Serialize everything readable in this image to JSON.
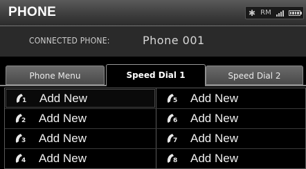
{
  "title": "PHONE",
  "status": {
    "bluetooth_icon": "bluetooth-icon",
    "rm_label": "RM",
    "signal_icon": "signal-strength-icon",
    "battery_icon": "battery-icon"
  },
  "connected": {
    "label": "CONNECTED PHONE:",
    "value": "Phone 001"
  },
  "tabs": [
    {
      "label": "Phone Menu",
      "active": false
    },
    {
      "label": "Speed Dial 1",
      "active": true
    },
    {
      "label": "Speed Dial 2",
      "active": false
    }
  ],
  "entries": [
    {
      "number": "1",
      "label": "Add New",
      "icon": "phone-handset-icon"
    },
    {
      "number": "2",
      "label": "Add New",
      "icon": "phone-handset-icon"
    },
    {
      "number": "3",
      "label": "Add New",
      "icon": "phone-handset-icon"
    },
    {
      "number": "4",
      "label": "Add New",
      "icon": "phone-handset-icon"
    },
    {
      "number": "5",
      "label": "Add New",
      "icon": "phone-handset-icon"
    },
    {
      "number": "6",
      "label": "Add New",
      "icon": "phone-handset-icon"
    },
    {
      "number": "7",
      "label": "Add New",
      "icon": "phone-handset-icon"
    },
    {
      "number": "8",
      "label": "Add New",
      "icon": "phone-handset-icon"
    }
  ],
  "colors": {
    "background": "#000000",
    "title_bar": "#3e3e3e",
    "text": "#f0f0f0",
    "tab_inactive": "#5a5a5a"
  }
}
